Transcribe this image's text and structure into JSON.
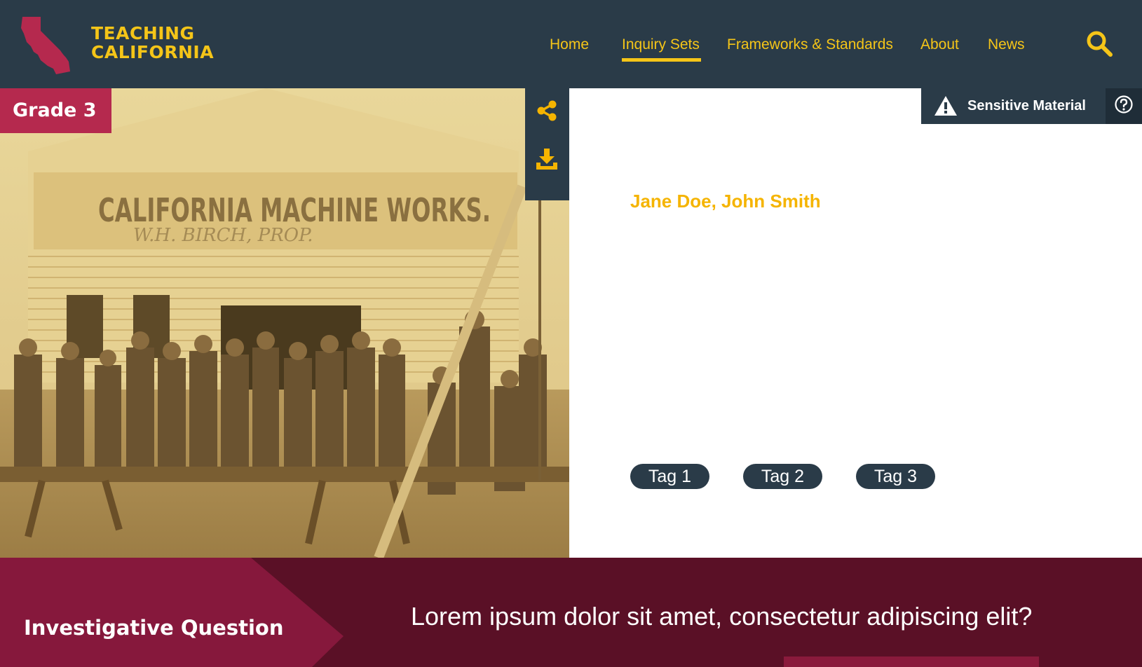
{
  "header": {
    "brand_line1": "TEACHING",
    "brand_line2": "CALIFORNIA",
    "nav": [
      {
        "label": "Home",
        "active": false
      },
      {
        "label": "Inquiry Sets",
        "active": true
      },
      {
        "label": "Frameworks & Standards",
        "active": false
      },
      {
        "label": "About",
        "active": false
      },
      {
        "label": "News",
        "active": false
      }
    ],
    "search_icon": "search-icon"
  },
  "hero": {
    "grade_label": "Grade 3",
    "sign_text": "CALIFORNIA MACHINE WORKS.",
    "sign_subtext": "W.H. BIRCH, PROP."
  },
  "toolbar": {
    "share_icon": "share-icon",
    "download_icon": "download-icon"
  },
  "detail": {
    "sensitive_label": "Sensitive Material",
    "authors": "Jane Doe, John Smith",
    "tags": [
      "Tag 1",
      "Tag 2",
      "Tag 3"
    ]
  },
  "question_band": {
    "label": "Investigative Question",
    "question": "Lorem ipsum dolor sit amet, consectetur adipiscing elit?"
  },
  "colors": {
    "header_bg": "#2a3b48",
    "accent_yellow": "#f5c518",
    "brand_red": "#b5294e",
    "band_dark": "#5a1026",
    "band_light": "#86183c"
  }
}
